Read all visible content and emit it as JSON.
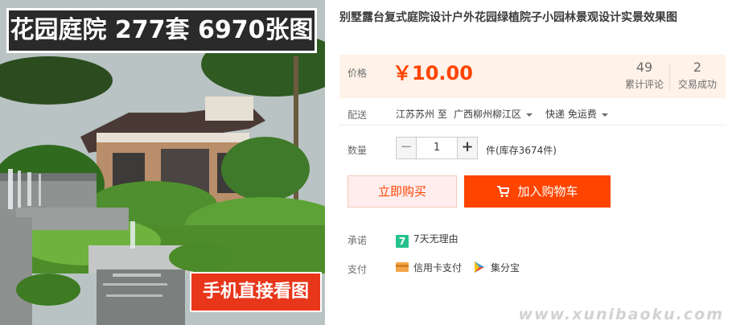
{
  "hero": {
    "title": "花园庭院 277套 6970张图",
    "badge": "手机直接看图"
  },
  "product": {
    "title": "别墅露台复式庭院设计户外花园绿植院子小园林景观设计实景效果图"
  },
  "price": {
    "label": "价格",
    "value": "￥10.00",
    "reviews_count": "49",
    "reviews_label": "累计评论",
    "deals_count": "2",
    "deals_label": "交易成功"
  },
  "shipping": {
    "label": "配送",
    "from": "江苏苏州 至",
    "to": "广西柳州柳江区",
    "method": "快递 免运费"
  },
  "quantity": {
    "label": "数量",
    "minus": "−",
    "value": "1",
    "plus": "+",
    "stock": "件(库存3674件)"
  },
  "actions": {
    "buy_now": "立即购买",
    "add_to_cart": "加入购物车"
  },
  "promise": {
    "label": "承诺",
    "icon_text": "7",
    "text": "7天无理由"
  },
  "payment": {
    "label": "支付",
    "credit": "信用卡支付",
    "points": "集分宝"
  },
  "watermark": "www.xunibaoku.com",
  "colors": {
    "accent": "#ff4400",
    "price_bg": "#fff2e8",
    "badge_red": "#e8361b",
    "promise_green": "#25c28d"
  },
  "icons": [
    "cart-icon",
    "seven-day-icon",
    "credit-card-icon",
    "jifenbao-icon"
  ]
}
